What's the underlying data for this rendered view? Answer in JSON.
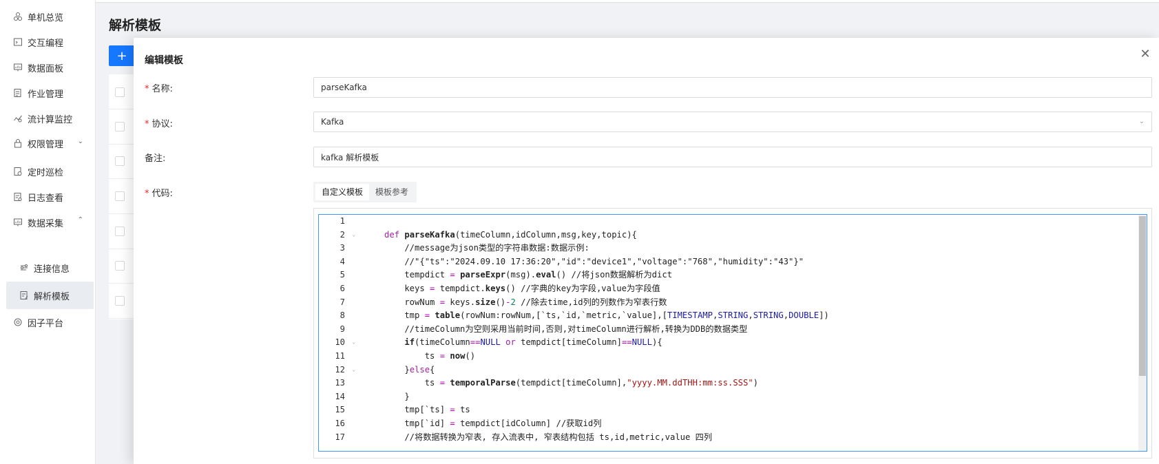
{
  "sidebar": {
    "items": [
      {
        "label": "单机总览",
        "icon": "cluster-icon"
      },
      {
        "label": "交互编程",
        "icon": "code-icon"
      },
      {
        "label": "数据面板",
        "icon": "dashboard-icon"
      },
      {
        "label": "作业管理",
        "icon": "job-icon"
      },
      {
        "label": "流计算监控",
        "icon": "stream-icon"
      },
      {
        "label": "权限管理",
        "icon": "lock-icon"
      },
      {
        "label": "定时巡检",
        "icon": "clock-icon"
      },
      {
        "label": "日志查看",
        "icon": "log-icon"
      },
      {
        "label": "数据采集",
        "icon": "collect-icon"
      },
      {
        "label": "连接信息",
        "icon": "connection-icon"
      },
      {
        "label": "解析模板",
        "icon": "template-icon"
      },
      {
        "label": "因子平台",
        "icon": "factor-icon"
      }
    ]
  },
  "page": {
    "title": "解析模板",
    "add_label": "+"
  },
  "drawer": {
    "title": "编辑模板",
    "close": "✕",
    "fields": {
      "name": {
        "label": "名称:",
        "value": "parseKafka"
      },
      "protocol": {
        "label": "协议:",
        "value": "Kafka"
      },
      "remark": {
        "label": "备注:",
        "value": "kafka 解析模板"
      },
      "code": {
        "label": "代码:"
      }
    },
    "tabs": [
      "自定义模板",
      "模板参考"
    ]
  },
  "code": {
    "lines": [
      "",
      "def parseKafka(timeColumn,idColumn,msg,key,topic){",
      "    //message为json类型的字符串数据:数据示例:",
      "    //\"{\"ts\":\"2024.09.10 17:36:20\",\"id\":\"device1\",\"voltage\":\"768\",\"humidity\":\"43\"}\"",
      "    tempdict = parseExpr(msg).eval() //将json数据解析为dict",
      "    keys = tempdict.keys() //字典的key为字段,value为字段值",
      "    rowNum = keys.size()-2 //除去time,id列的列数作为窄表行数",
      "    tmp = table(rowNum:rowNum,[`ts,`id,`metric,`value],[TIMESTAMP,STRING,STRING,DOUBLE])",
      "    //timeColumn为空则采用当前时间,否则,对timeColumn进行解析,转换为DDB的数据类型",
      "    if(timeColumn==NULL or tempdict[timeColumn]==NULL){",
      "        ts = now()",
      "    }else{",
      "        ts = temporalParse(tempdict[timeColumn],\"yyyy.MM.ddTHH:mm:ss.SSS\")",
      "    }",
      "    tmp[`ts] = ts",
      "    tmp[`id] = tempdict[idColumn] //获取id列",
      "    //将数据转换为窄表, 存入流表中, 窄表结构包括 ts,id,metric,value 四列"
    ]
  }
}
